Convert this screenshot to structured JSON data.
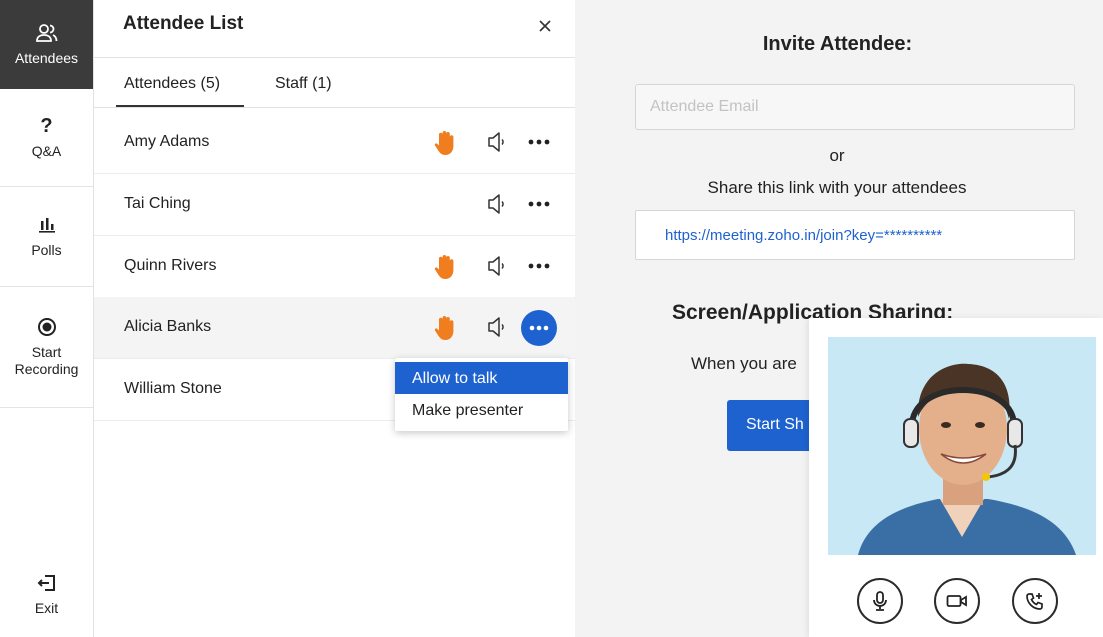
{
  "rail": {
    "items": [
      {
        "label": "Attendees",
        "icon": "attendees-icon"
      },
      {
        "label": "Q&A",
        "icon": "question-icon"
      },
      {
        "label": "Polls",
        "icon": "poll-icon"
      },
      {
        "label": "Start Recording",
        "icon": "record-icon"
      }
    ],
    "exit_label": "Exit"
  },
  "panel": {
    "title": "Attendee List",
    "tabs": [
      {
        "label": "Attendees (5)",
        "selected": true
      },
      {
        "label": "Staff (1)",
        "selected": false
      }
    ],
    "attendees": [
      {
        "name": "Amy Adams",
        "hand_raised": true
      },
      {
        "name": "Tai Ching",
        "hand_raised": false
      },
      {
        "name": "Quinn Rivers",
        "hand_raised": true
      },
      {
        "name": "Alicia Banks",
        "hand_raised": true
      },
      {
        "name": "William Stone",
        "hand_raised": false
      }
    ],
    "context_menu": {
      "items": [
        "Allow to talk",
        "Make presenter"
      ],
      "selected": "Allow to talk"
    }
  },
  "invite": {
    "title": "Invite Attendee:",
    "email_placeholder": "Attendee Email",
    "or_text": "or",
    "share_text": "Share this link with your attendees",
    "link": "https://meeting.zoho.in/join?key=**********"
  },
  "screen_share": {
    "title": "Screen/Application Sharing:",
    "description_visible": "When you are",
    "button_visible": "Start Sh"
  },
  "colors": {
    "accent": "#1e62d0",
    "hand": "#f07d1e",
    "rail_active": "#3b3b3b"
  }
}
